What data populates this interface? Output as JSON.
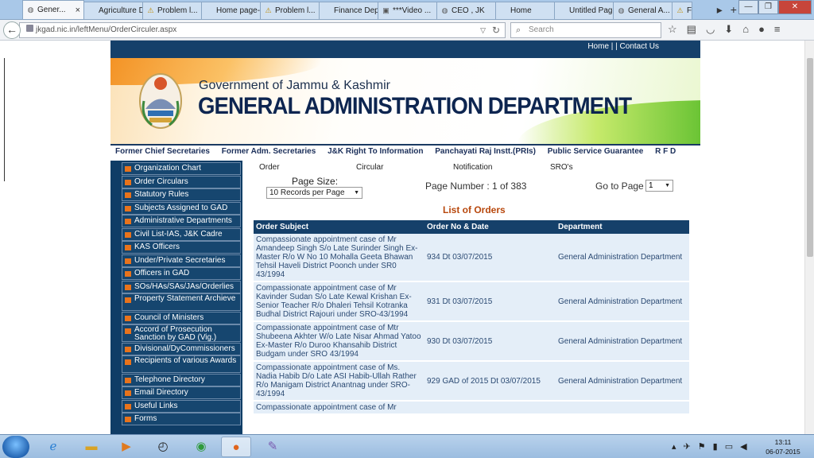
{
  "browser": {
    "tabs": [
      {
        "label": "Gener...",
        "icon": "globe-icon",
        "active": true
      },
      {
        "label": "Agriculture D...",
        "icon": "page-icon"
      },
      {
        "label": "Problem l...",
        "icon": "warning-icon"
      },
      {
        "label": "Home page-...",
        "icon": "page-icon"
      },
      {
        "label": "Problem l...",
        "icon": "warning-icon"
      },
      {
        "label": "Finance Depa...",
        "icon": "page-icon"
      },
      {
        "label": "***Video ...",
        "icon": "video-icon"
      },
      {
        "label": "CEO , JK",
        "icon": "globe-icon"
      },
      {
        "label": "Home",
        "icon": "page-icon"
      },
      {
        "label": "Untitled Page",
        "icon": "page-icon"
      },
      {
        "label": "General A...",
        "icon": "globe-icon"
      },
      {
        "label": "F",
        "icon": "warning-icon"
      }
    ],
    "url": "jkgad.nic.in/leftMenu/OrderCirculer.aspx",
    "search_placeholder": "Search"
  },
  "site": {
    "top_links": "Home | | Contact Us",
    "gov_title": "Government of Jammu & Kashmir",
    "dept_title": "GENERAL ADMINISTRATION DEPARTMENT",
    "nav_links": [
      "Former Chief Secretaries",
      "Former Adm. Secretaries",
      "J&K Right To Information",
      "Panchayati Raj Instt.(PRIs)",
      "Public Service Guarantee",
      "R F D"
    ]
  },
  "sidebar": {
    "items": [
      "Organization Chart",
      "Order Circulars",
      "Statutory Rules",
      "Subjects Assigned to GAD",
      "Administrative Departments",
      "Civil List-IAS, J&K Cadre",
      "KAS Officers",
      "Under/Private Secretaries",
      "Officers in GAD",
      "SOs/HAs/SAs/JAs/Orderlies",
      "Property Statement Archieve",
      "Council of Ministers",
      "Accord of Prosecution Sanction by GAD (Vig.)",
      "Divisional/DyCommissioners",
      "Recipients of various Awards",
      "Telephone Directory",
      "Email Directory",
      "Useful Links",
      "Forms"
    ]
  },
  "main": {
    "tabs": [
      "Order",
      "Circular",
      "Notification",
      "SRO's"
    ],
    "page_size_label": "Page Size:",
    "page_size_value": "10 Records per Page",
    "page_number": "Page Number : 1 of 383",
    "goto_label": "Go to Page",
    "goto_value": "1",
    "list_title": "List of Orders",
    "columns": [
      "Order Subject",
      "Order No & Date",
      "Department"
    ],
    "rows": [
      {
        "subject": "Compassionate appointment case of Mr Amandeep Singh S/o Late Surinder Singh Ex-Master R/o W No 10 Mohalla Geeta Bhawan Tehsil Haveli District Poonch under SR0 43/1994",
        "order": "934 Dt 03/07/2015",
        "dept": "General Administration Department"
      },
      {
        "subject": "Compassionate appointment case of Mr Kavinder Sudan S/o Late Kewal Krishan Ex-Senior Teacher R/o Dhaleri Tehsil Kotranka Budhal District Rajouri under SRO-43/1994",
        "order": "931 Dt 03/07/2015",
        "dept": "General Administration Department"
      },
      {
        "subject": "Compassionate appointment case of Mtr Shubeena Akhter W/o Late Nisar Ahmad Yatoo Ex-Master R/o Duroo Khansahib District Budgam under SRO 43/1994",
        "order": "930 Dt 03/07/2015",
        "dept": "General Administration Department"
      },
      {
        "subject": "Compassionate appointment case of Ms. Nadia Habib D/o Late ASI Habib-Ullah Rather R/o Manigam District Anantnag under SRO-43/1994",
        "order": "929 GAD of 2015 Dt 03/07/2015",
        "dept": "General Administration Department"
      },
      {
        "subject": "Compassionate appointment case of Mr",
        "order": "",
        "dept": ""
      }
    ]
  },
  "taskbar": {
    "time": "13:11",
    "date": "06-07-2015"
  }
}
